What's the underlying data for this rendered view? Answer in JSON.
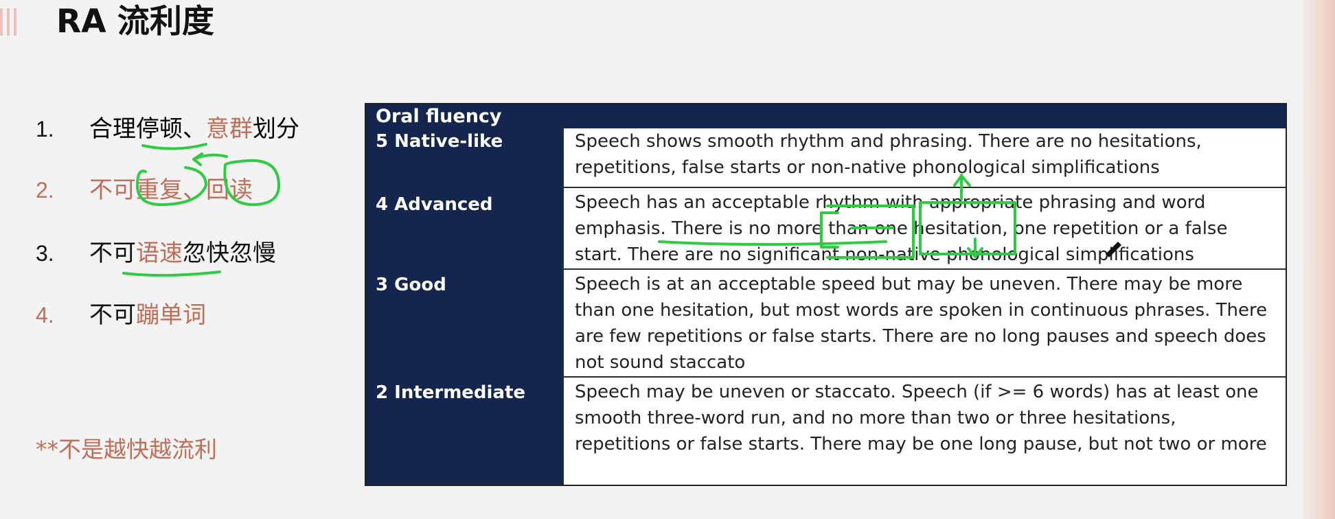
{
  "title": "RA 流利度",
  "points": [
    {
      "num": "1.",
      "segments": [
        {
          "text": "合理",
          "tone": "black"
        },
        {
          "text": "停顿",
          "tone": "black"
        },
        {
          "text": "、",
          "tone": "black"
        },
        {
          "text": "意群",
          "tone": "red"
        },
        {
          "text": "划分",
          "tone": "black"
        }
      ]
    },
    {
      "num": "2.",
      "segments": [
        {
          "text": "不可",
          "tone": "red"
        },
        {
          "text": "重复",
          "tone": "red"
        },
        {
          "text": "、",
          "tone": "red"
        },
        {
          "text": "回读",
          "tone": "red"
        }
      ]
    },
    {
      "num": "3.",
      "segments": [
        {
          "text": "不可",
          "tone": "black"
        },
        {
          "text": "语速",
          "tone": "red"
        },
        {
          "text": "忽快忽慢",
          "tone": "black"
        }
      ]
    },
    {
      "num": "4.",
      "segments": [
        {
          "text": "不可",
          "tone": "black"
        },
        {
          "text": "蹦单词",
          "tone": "red"
        }
      ]
    }
  ],
  "footnote": "**不是越快越流利",
  "rubric": {
    "header": "Oral fluency",
    "rows": [
      {
        "level": "5 Native-like",
        "description": "Speech shows smooth rhythm and phrasing. There are no hesitations, repetitions, false starts or non-native phonological simplifications"
      },
      {
        "level": "4 Advanced",
        "description": "Speech has an acceptable rhythm with appropriate phrasing and word emphasis. There is no more than one hesitation, one repetition or a false start. There are no significant non-native phonological simplifications"
      },
      {
        "level": "3 Good",
        "description": "Speech is at an acceptable speed but may be uneven. There may be more than one hesitation, but most words are spoken in continuous phrases. There are few repetitions or false starts. There are no long pauses and speech does not sound staccato"
      },
      {
        "level": "2 Intermediate",
        "description": "Speech may be uneven or staccato. Speech (if >= 6 words) has at least one smooth three-word run, and no more than two or three hesitations, repetitions or false starts. There may be one long pause, but not two or more"
      }
    ]
  },
  "colors": {
    "accent_red": "#bf6e58",
    "navy": "#14264d",
    "ink_green": "#2ecc40"
  }
}
